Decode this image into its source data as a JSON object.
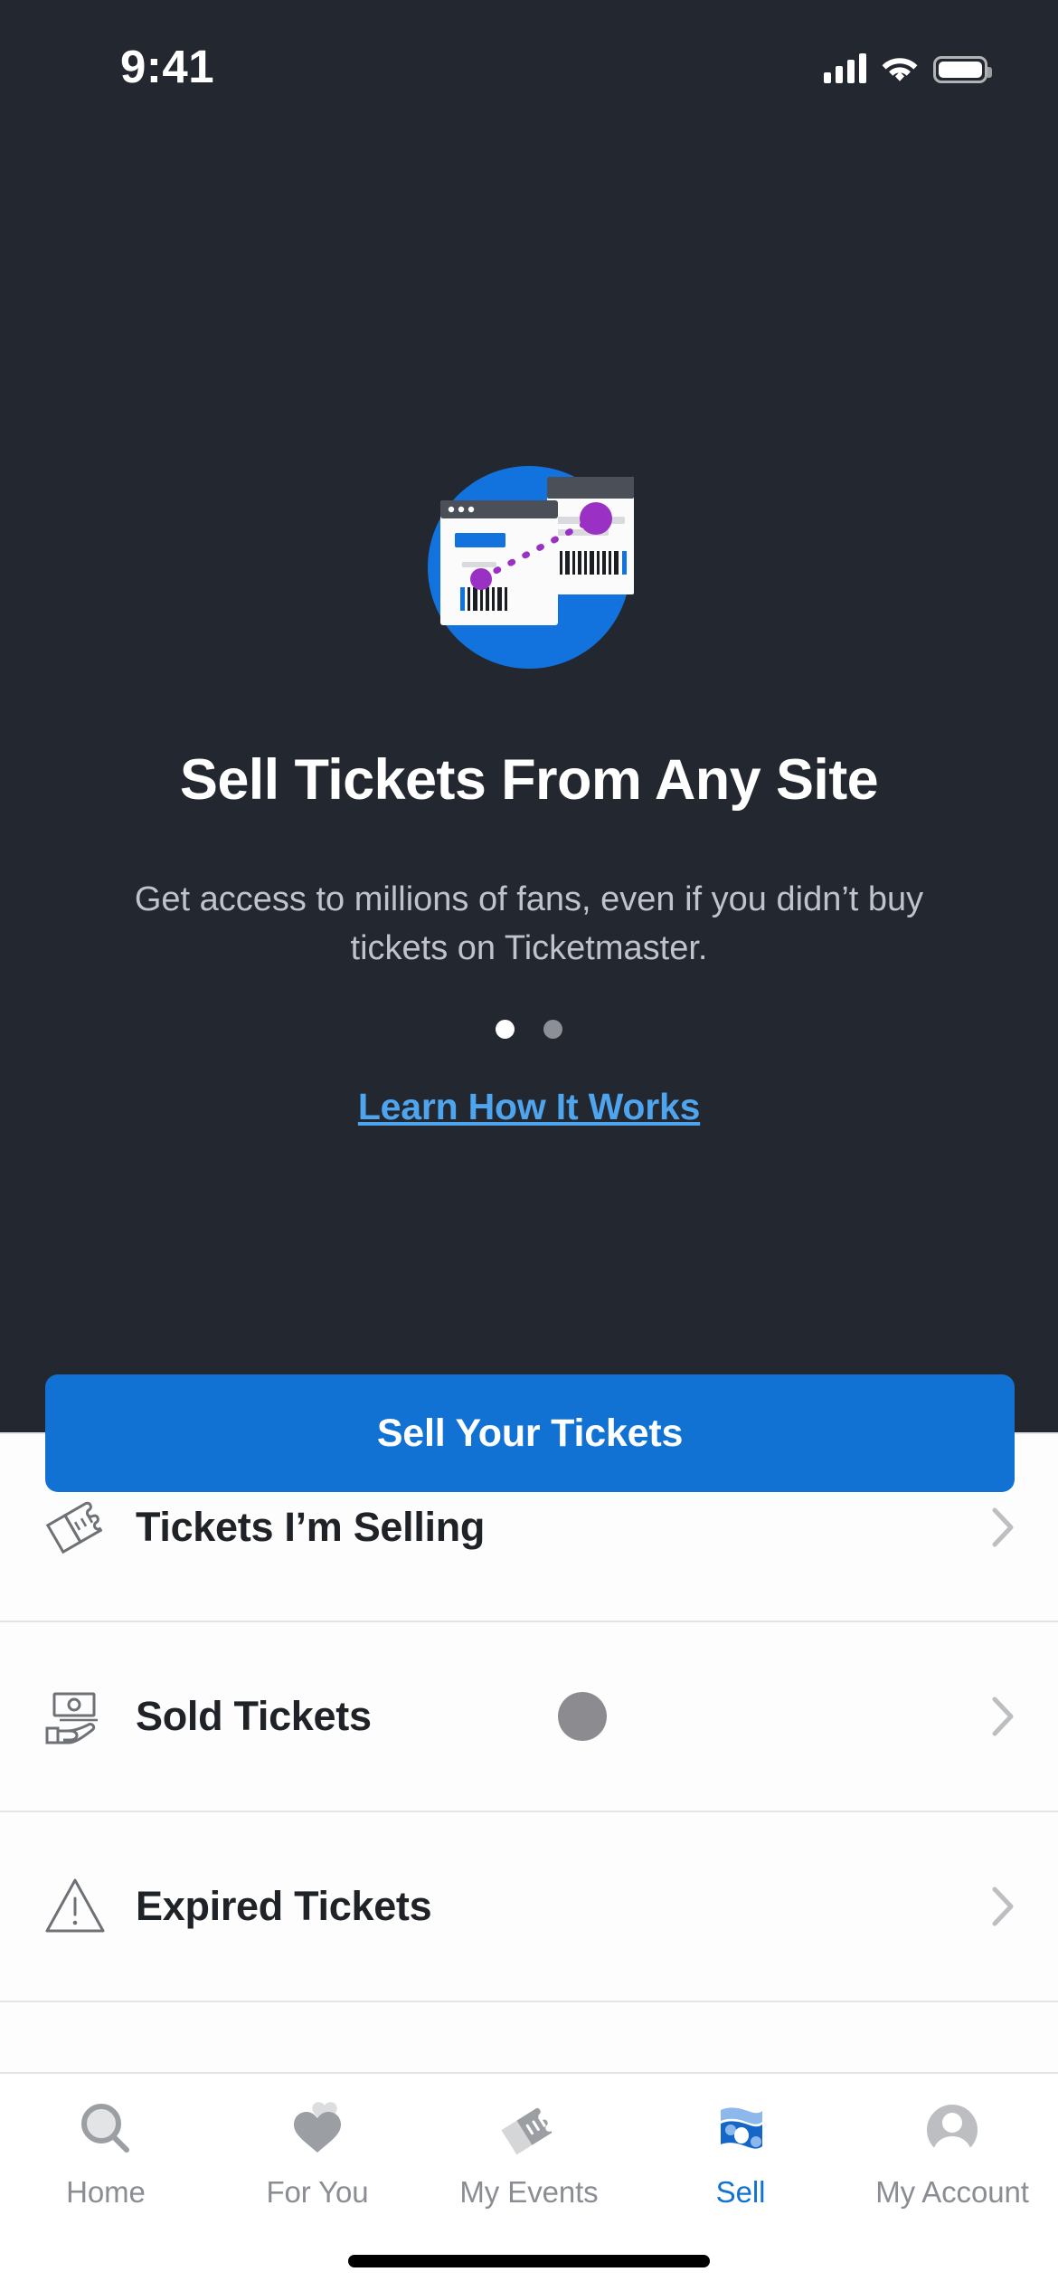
{
  "status_bar": {
    "time": "9:41",
    "signal_icon": "cellular-signal-icon",
    "wifi_icon": "wifi-icon",
    "battery_icon": "battery-icon"
  },
  "hero": {
    "illustration_name": "sell-tickets-any-site-illustration",
    "title": "Sell Tickets From Any Site",
    "subtitle": "Get access to millions of fans, even if you didn’t buy tickets on Ticketmaster.",
    "carousel": {
      "total_dots": 2,
      "active_index": 0
    },
    "link_label": "Learn How It Works",
    "background_color": "#23272F",
    "link_color": "#4FA4EE"
  },
  "cta": {
    "label": "Sell Your Tickets",
    "color": "#1272D4"
  },
  "list": {
    "rows": [
      {
        "label": "Tickets I’m Selling",
        "icon": "tickets-icon",
        "badge": null,
        "chevron": "chevron-right-icon"
      },
      {
        "label": "Sold Tickets",
        "icon": "money-in-hand-icon",
        "badge": "",
        "badge_color": "#8C8C90",
        "chevron": "chevron-right-icon"
      },
      {
        "label": "Expired Tickets",
        "icon": "warning-triangle-icon",
        "badge": null,
        "chevron": "chevron-right-icon"
      }
    ]
  },
  "tabbar": {
    "active_index": 3,
    "active_color": "#1272D4",
    "inactive_color": "#8A8D93",
    "tabs": [
      {
        "label": "Home",
        "icon": "search-icon"
      },
      {
        "label": "For You",
        "icon": "hearts-icon"
      },
      {
        "label": "My Events",
        "icon": "tickets-icon"
      },
      {
        "label": "Sell",
        "icon": "cash-icon"
      },
      {
        "label": "My Account",
        "icon": "person-icon"
      }
    ]
  }
}
